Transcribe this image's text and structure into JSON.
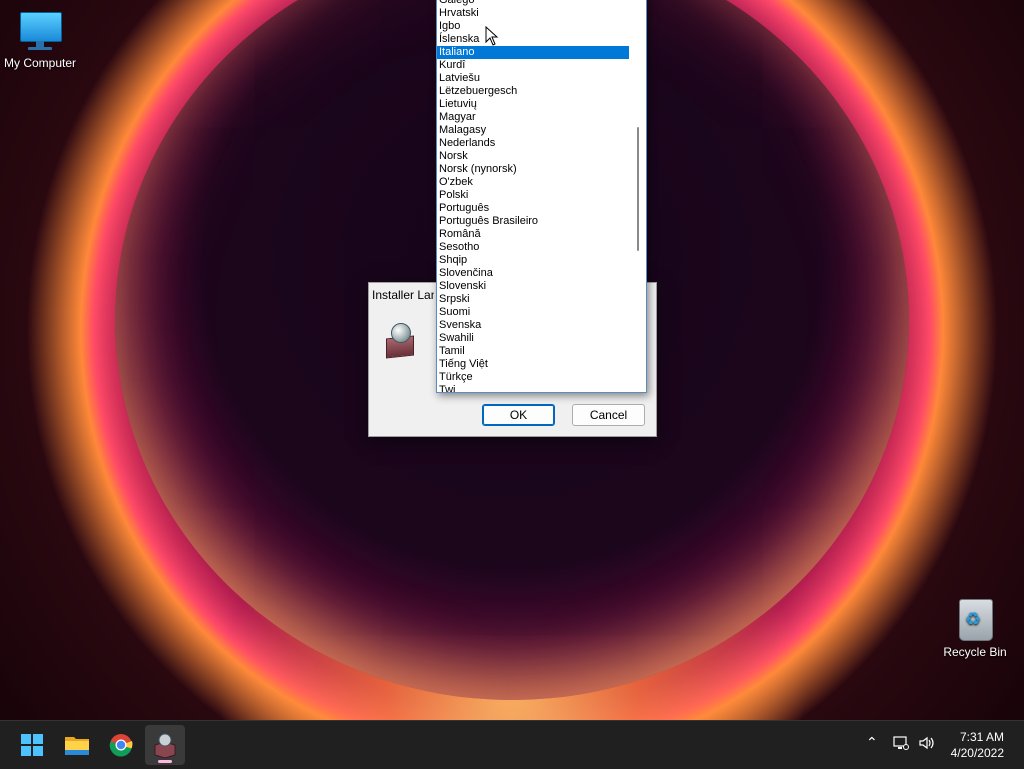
{
  "desktop": {
    "icons": [
      {
        "label": "My Computer"
      },
      {
        "label": "Recycle Bin"
      }
    ]
  },
  "dialog": {
    "title": "Installer Language",
    "ok_label": "OK",
    "cancel_label": "Cancel",
    "languages": [
      {
        "label": "Galego"
      },
      {
        "label": "Hrvatski"
      },
      {
        "label": "Igbo"
      },
      {
        "label": "Íslenska"
      },
      {
        "label": "Italiano",
        "selected": true
      },
      {
        "label": "Kurdî"
      },
      {
        "label": "Latviešu"
      },
      {
        "label": "Lëtzebuergesch"
      },
      {
        "label": "Lietuvių"
      },
      {
        "label": "Magyar"
      },
      {
        "label": "Malagasy"
      },
      {
        "label": "Nederlands"
      },
      {
        "label": "Norsk"
      },
      {
        "label": "Norsk (nynorsk)"
      },
      {
        "label": "O'zbek"
      },
      {
        "label": "Polski"
      },
      {
        "label": "Português"
      },
      {
        "label": "Português Brasileiro"
      },
      {
        "label": "Română"
      },
      {
        "label": "Sesotho"
      },
      {
        "label": "Shqip"
      },
      {
        "label": "Slovenčina"
      },
      {
        "label": "Slovenski"
      },
      {
        "label": "Srpski"
      },
      {
        "label": "Suomi"
      },
      {
        "label": "Svenska"
      },
      {
        "label": "Swahili"
      },
      {
        "label": "Tamil"
      },
      {
        "label": "Tiếng Việt"
      },
      {
        "label": "Türkçe"
      },
      {
        "label": "Twi"
      }
    ]
  },
  "taskbar": {
    "apps": [
      "start-icon",
      "file-explorer-icon",
      "chrome-icon",
      "installer-icon"
    ],
    "active_app": "installer-icon",
    "clock": {
      "time": "7:31 AM",
      "date": "4/20/2022"
    }
  },
  "colors": {
    "selection": "#0078d7",
    "accent": "#0067c0",
    "taskbar_bg": "#202020"
  }
}
